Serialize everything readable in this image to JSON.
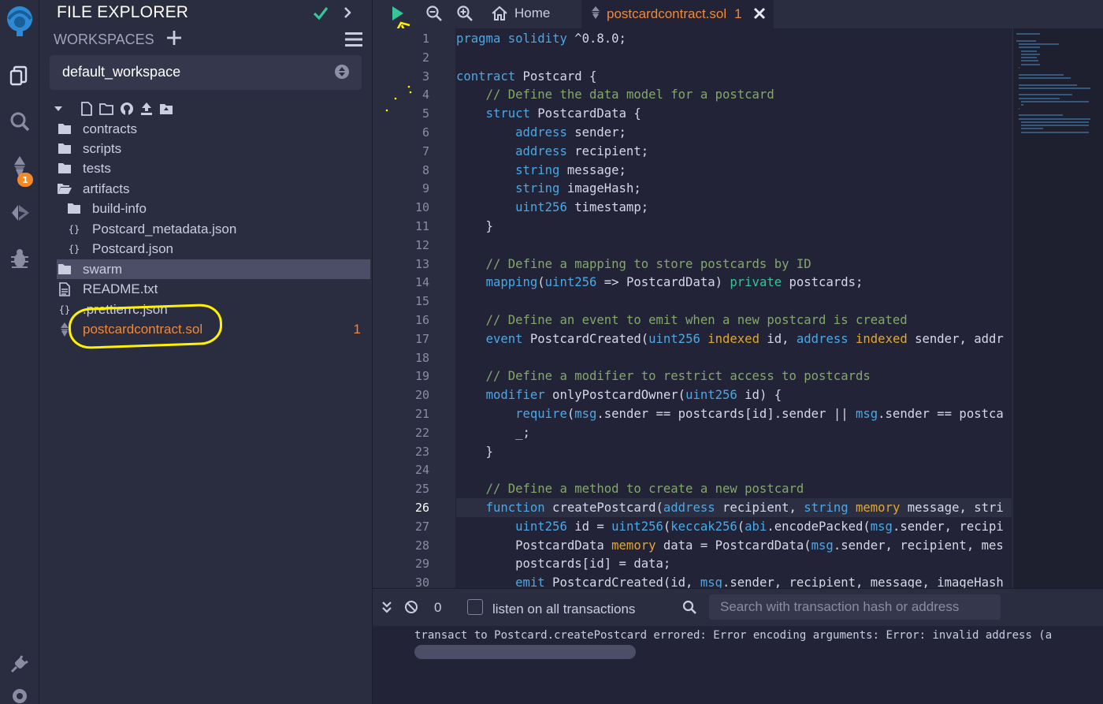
{
  "explorer": {
    "title": "FILE EXPLORER",
    "workspaces_label": "WORKSPACES",
    "workspace_value": "default_workspace",
    "tree": [
      {
        "label": "contracts",
        "type": "folder"
      },
      {
        "label": "scripts",
        "type": "folder"
      },
      {
        "label": "tests",
        "type": "folder"
      },
      {
        "label": "artifacts",
        "type": "folder-open"
      },
      {
        "label": "build-info",
        "type": "folder"
      },
      {
        "label": "Postcard_metadata.json",
        "type": "json"
      },
      {
        "label": "Postcard.json",
        "type": "json"
      },
      {
        "label": "swarm",
        "type": "folder"
      },
      {
        "label": "README.txt",
        "type": "text"
      },
      {
        "label": ".prettierrc.json",
        "type": "json"
      },
      {
        "label": "postcardcontract.sol",
        "type": "solidity",
        "count": "1"
      }
    ]
  },
  "rail": {
    "badge": "1"
  },
  "tabs": {
    "home_label": "Home",
    "file_label": "postcardcontract.sol",
    "file_count": "1"
  },
  "editor": {
    "line_numbers": [
      "1",
      "2",
      "3",
      "4",
      "5",
      "6",
      "7",
      "8",
      "9",
      "10",
      "11",
      "12",
      "13",
      "14",
      "15",
      "16",
      "17",
      "18",
      "19",
      "20",
      "21",
      "22",
      "23",
      "24",
      "25",
      "26",
      "27",
      "28",
      "29",
      "30"
    ],
    "active_line": "26",
    "lines": [
      "pragma solidity ^0.8.0;",
      "",
      "contract Postcard {",
      "    // Define the data model for a postcard",
      "    struct PostcardData {",
      "        address sender;",
      "        address recipient;",
      "        string message;",
      "        string imageHash;",
      "        uint256 timestamp;",
      "    }",
      "",
      "    // Define a mapping to store postcards by ID",
      "    mapping(uint256 => PostcardData) private postcards;",
      "",
      "    // Define an event to emit when a new postcard is created",
      "    event PostcardCreated(uint256 indexed id, address indexed sender, addr",
      "",
      "    // Define a modifier to restrict access to postcards",
      "    modifier onlyPostcardOwner(uint256 id) {",
      "        require(msg.sender == postcards[id].sender || msg.sender == postca",
      "        _;",
      "    }",
      "",
      "    // Define a method to create a new postcard",
      "    function createPostcard(address recipient, string memory message, stri",
      "        uint256 id = uint256(keccak256(abi.encodePacked(msg.sender, recipi",
      "        PostcardData memory data = PostcardData(msg.sender, recipient, mes",
      "        postcards[id] = data;",
      "        emit PostcardCreated(id, msg.sender, recipient, message, imageHash"
    ]
  },
  "terminal": {
    "count": "0",
    "listen_label": "listen on all transactions",
    "search_placeholder": "Search with transaction hash or address",
    "log_line": "transact to Postcard.createPostcard errored: Error encoding arguments: Error: invalid address (a"
  },
  "colors": {
    "background": "#222336",
    "panel": "#2a2c3f",
    "accent_orange": "#f0883b",
    "accent_green": "#36c49a",
    "annotation_yellow": "#fff200"
  }
}
